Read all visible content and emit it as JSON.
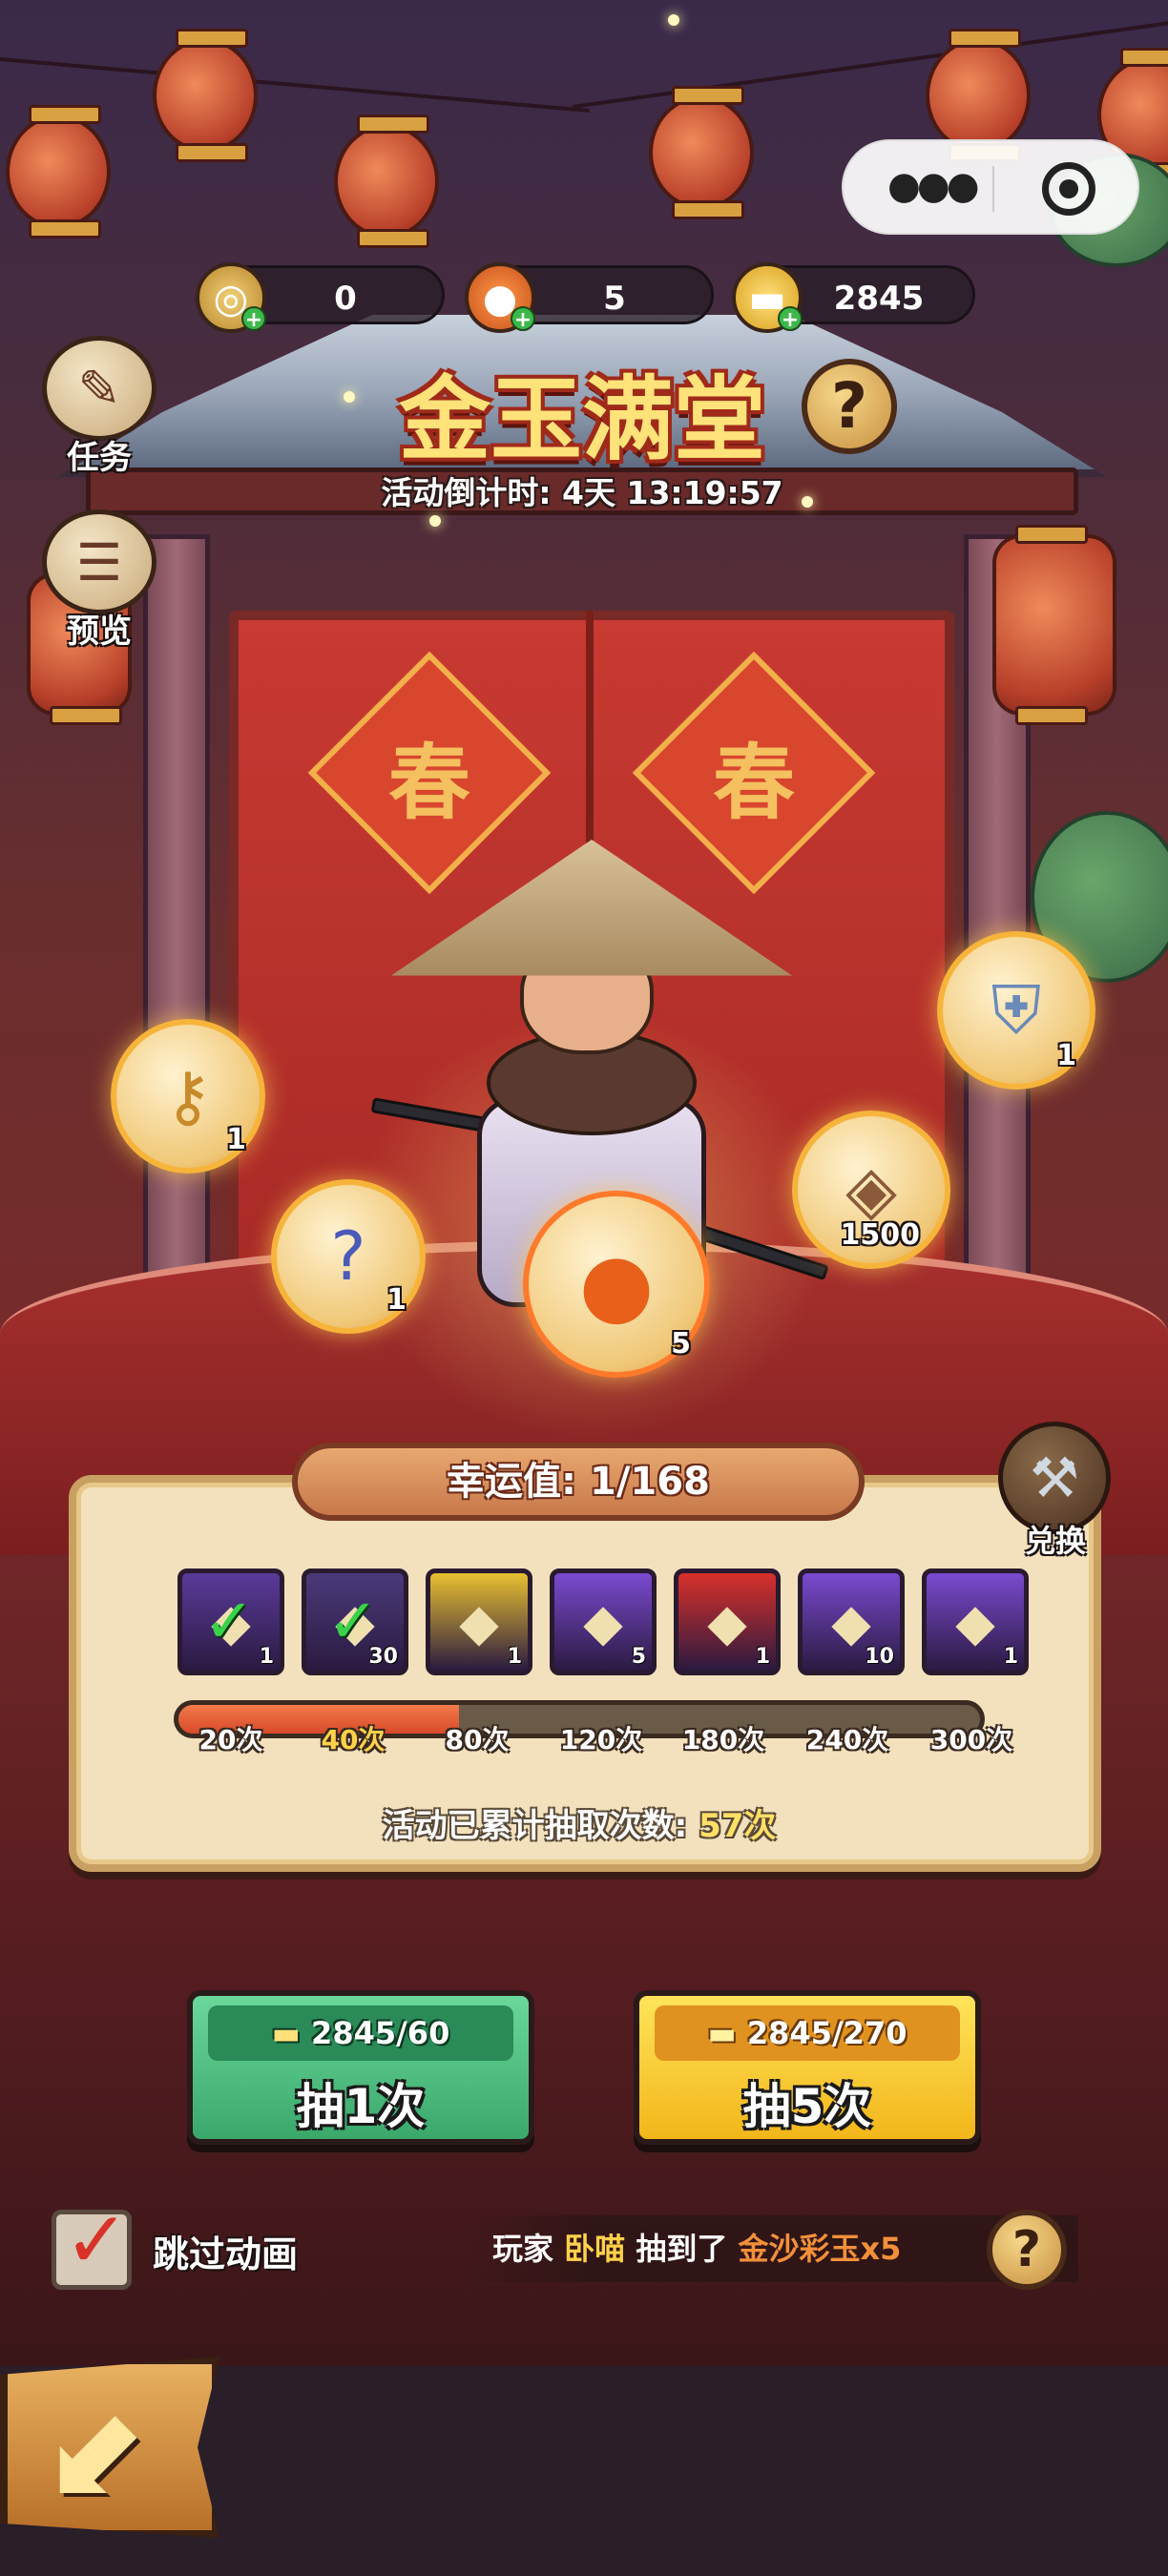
{
  "status_bar": {
    "menu_icon": "more-dots-icon",
    "close_icon": "target-circle-icon"
  },
  "currencies": [
    {
      "icon": "jade-ticket-icon",
      "value": "0"
    },
    {
      "icon": "gold-jade-icon",
      "value": "5"
    },
    {
      "icon": "gold-ingot-icon",
      "value": "2845"
    }
  ],
  "header": {
    "title": "金玉满堂",
    "countdown_label": "活动倒计时:",
    "countdown_value": "4天 13:19:57"
  },
  "side_menu": [
    {
      "label": "任务",
      "icon": "quest-scroll-icon"
    },
    {
      "label": "预览",
      "icon": "preview-scroll-icon"
    }
  ],
  "rewards": [
    {
      "name": "key",
      "icon": "golden-key-icon",
      "count": "1"
    },
    {
      "name": "mystery-chest",
      "icon": "mystery-chest-icon",
      "count": "1"
    },
    {
      "name": "gold-jade",
      "icon": "gold-jade-icon",
      "count": "5"
    },
    {
      "name": "coin",
      "icon": "copper-coin-icon",
      "count": "1500"
    },
    {
      "name": "armor",
      "icon": "armor-icon",
      "count": "1"
    }
  ],
  "luck": {
    "title": "幸运值: 1/168",
    "exchange_label": "兑换",
    "milestones": [
      {
        "icon": "chest-purple-icon",
        "count": "1",
        "claimed": true,
        "color": "#5a3a9a"
      },
      {
        "icon": "rope-bundle-icon",
        "count": "30",
        "claimed": true,
        "color": "#4a3a7a"
      },
      {
        "icon": "hero-card-icon",
        "count": "1",
        "claimed": false,
        "color": "#e8c030"
      },
      {
        "icon": "jade-ticket-icon",
        "count": "5",
        "claimed": false,
        "color": "#7a4ad0"
      },
      {
        "icon": "hero-card-red-icon",
        "count": "1",
        "claimed": false,
        "color": "#d8302a"
      },
      {
        "icon": "jade-ticket-icon",
        "count": "10",
        "claimed": false,
        "color": "#7a4ad0"
      },
      {
        "icon": "weapon-card-icon",
        "count": "1",
        "claimed": false,
        "color": "#7a4ad0"
      }
    ],
    "progress_fraction": 0.35,
    "ticks": [
      "20次",
      "40次",
      "80次",
      "120次",
      "180次",
      "240次",
      "300次"
    ],
    "highlight_tick": 1,
    "cumulative_label": "活动已累计抽取次数:",
    "cumulative_value": "57次"
  },
  "draw_buttons": [
    {
      "cost": "2845/60",
      "label": "抽1次",
      "cost_icon": "gold-ingot-icon"
    },
    {
      "cost": "2845/270",
      "label": "抽5次",
      "cost_icon": "gold-ingot-icon"
    }
  ],
  "skip": {
    "label": "跳过动画",
    "checked": true
  },
  "log": {
    "prefix": "玩家",
    "player": "卧喵",
    "middle": "抽到了",
    "item": "金沙彩玉x5"
  },
  "decor": {
    "chun_char": "春"
  },
  "colors": {
    "accent_gold": "#ffe27a",
    "panel_bg": "#f2e1bc",
    "progress_fill": "#e8582e",
    "green_button": "#4ac07a",
    "yellow_button": "#f8cc2a"
  }
}
